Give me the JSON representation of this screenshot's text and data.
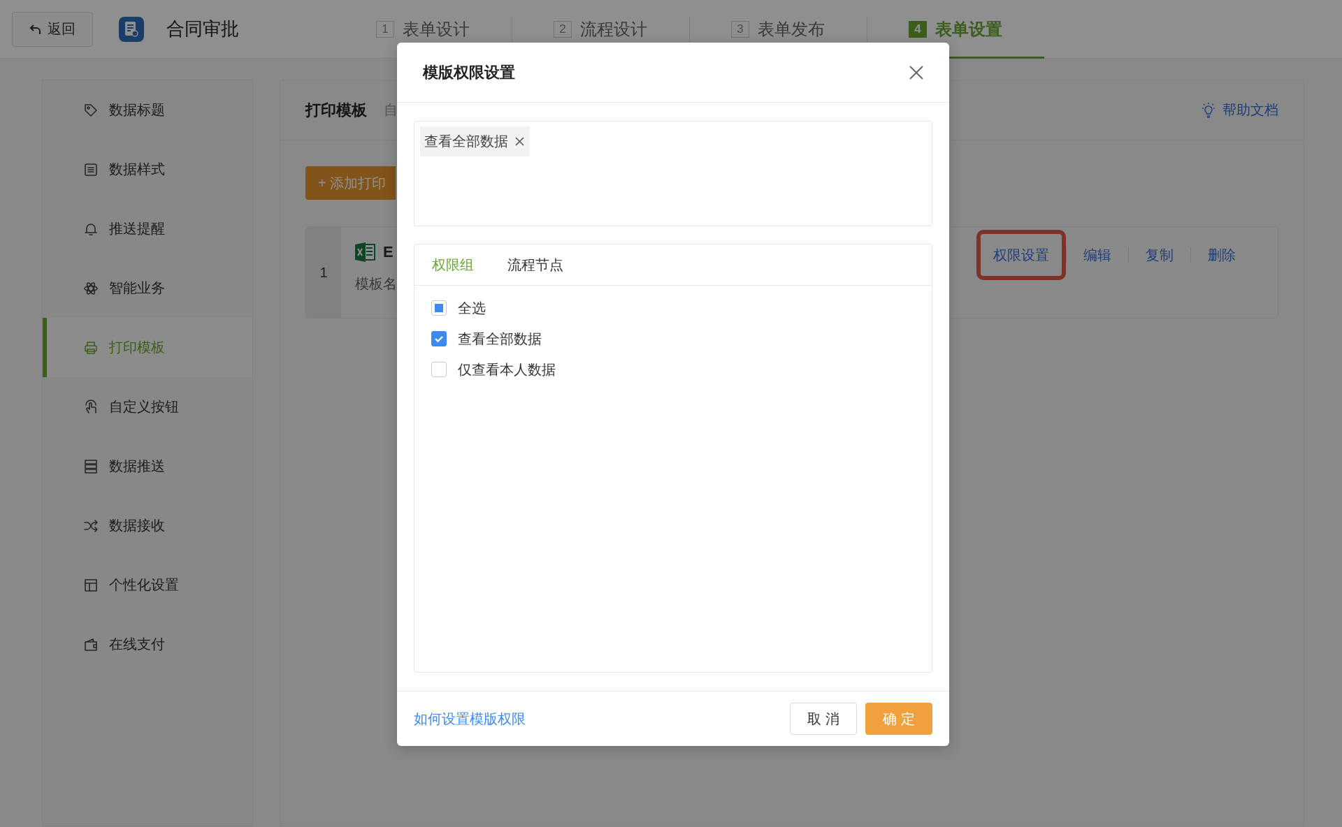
{
  "topbar": {
    "back": "返回",
    "title": "合同审批",
    "steps": [
      {
        "number": "1",
        "label": "表单设计",
        "selected": false
      },
      {
        "number": "2",
        "label": "流程设计",
        "selected": false
      },
      {
        "number": "3",
        "label": "表单发布",
        "selected": false
      },
      {
        "number": "4",
        "label": "表单设置",
        "selected": true
      }
    ]
  },
  "sidebar": {
    "items": [
      {
        "label": "数据标题",
        "selected": false
      },
      {
        "label": "数据样式",
        "selected": false
      },
      {
        "label": "推送提醒",
        "selected": false
      },
      {
        "label": "智能业务",
        "selected": false
      },
      {
        "label": "打印模板",
        "selected": true
      },
      {
        "label": "自定义按钮",
        "selected": false
      },
      {
        "label": "数据推送",
        "selected": false
      },
      {
        "label": "数据接收",
        "selected": false
      },
      {
        "label": "个性化设置",
        "selected": false
      },
      {
        "label": "在线支付",
        "selected": false
      }
    ]
  },
  "content": {
    "title": "打印模板",
    "subtitle": "自",
    "help": "帮助文档",
    "add_button": "+ 添加打印",
    "templates": [
      {
        "index": "1",
        "name": "E",
        "description": "模板名",
        "actions": [
          {
            "label": "权限设置",
            "highlighted": true
          },
          {
            "label": "编辑",
            "highlighted": false
          },
          {
            "label": "复制",
            "highlighted": false
          },
          {
            "label": "删除",
            "highlighted": false
          }
        ]
      }
    ]
  },
  "dialog": {
    "title": "模版权限设置",
    "tags": [
      "查看全部数据"
    ],
    "tabs": [
      {
        "label": "权限组",
        "selected": true
      },
      {
        "label": "流程节点",
        "selected": false
      }
    ],
    "options": [
      {
        "label": "全选",
        "checked": false,
        "indeterminate": true
      },
      {
        "label": "查看全部数据",
        "checked": true
      },
      {
        "label": "仅查看本人数据",
        "checked": false
      }
    ],
    "help_link": "如何设置模版权限",
    "buttons": [
      {
        "label": "取 消",
        "kind": "default"
      },
      {
        "label": "确 定",
        "kind": "primary"
      }
    ]
  }
}
